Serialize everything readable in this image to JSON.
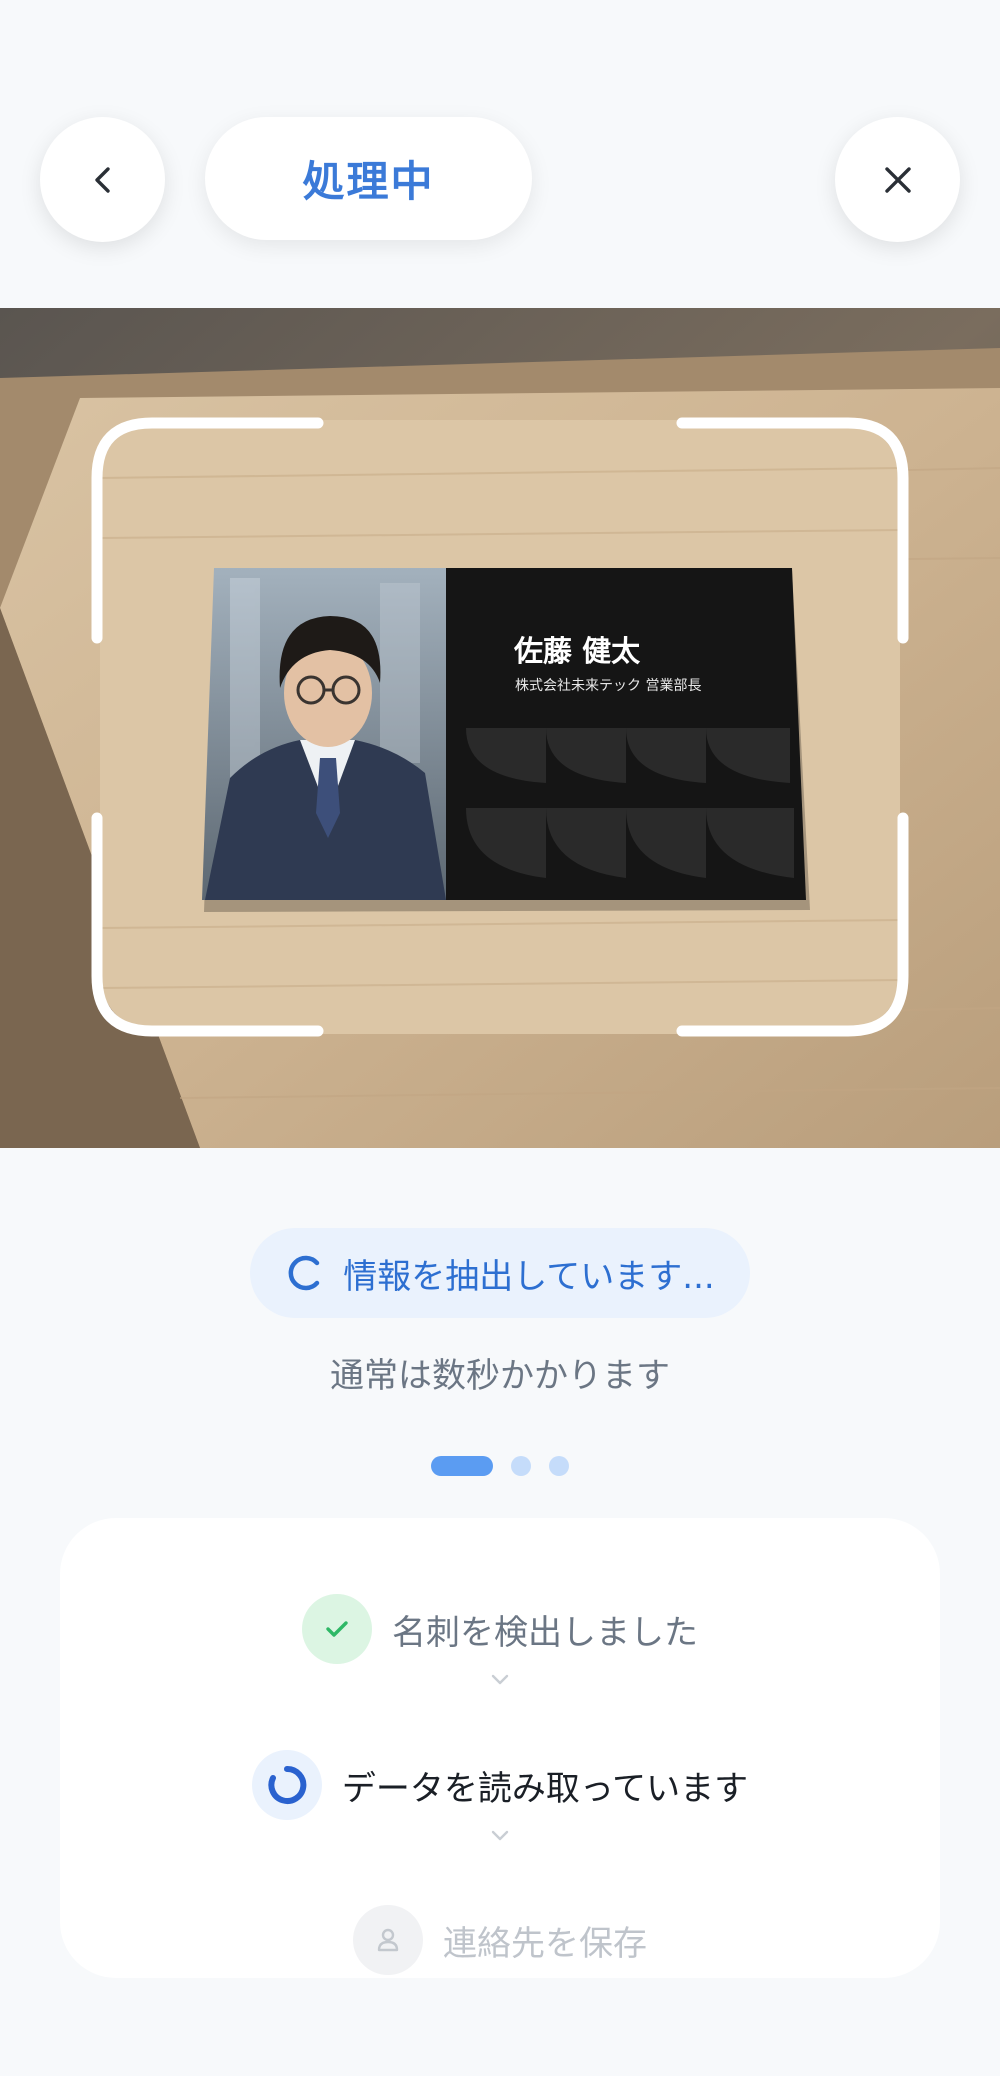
{
  "header": {
    "title": "処理中",
    "back_icon": "chevron-left-icon",
    "close_icon": "close-icon"
  },
  "card": {
    "name": "佐藤 健太",
    "title": "株式会社未来テック 営業部長"
  },
  "status": {
    "label": "情報を抽出しています...",
    "subtitle": "通常は数秒かかります",
    "icon": "spinner-icon"
  },
  "pager": {
    "total": 3,
    "active_index": 0
  },
  "steps": [
    {
      "label": "名刺を検出しました",
      "state": "done",
      "icon": "check-icon"
    },
    {
      "label": "データを読み取っています",
      "state": "in-progress",
      "icon": "spinner-icon"
    },
    {
      "label": "連絡先を保存",
      "state": "pending",
      "icon": "person-icon"
    }
  ],
  "colors": {
    "accent": "#3b7ad8",
    "status_text": "#2d6fd1",
    "done_green": "#2eb866",
    "muted_text": "#6b7684",
    "disabled_text": "#bfc4cb"
  }
}
